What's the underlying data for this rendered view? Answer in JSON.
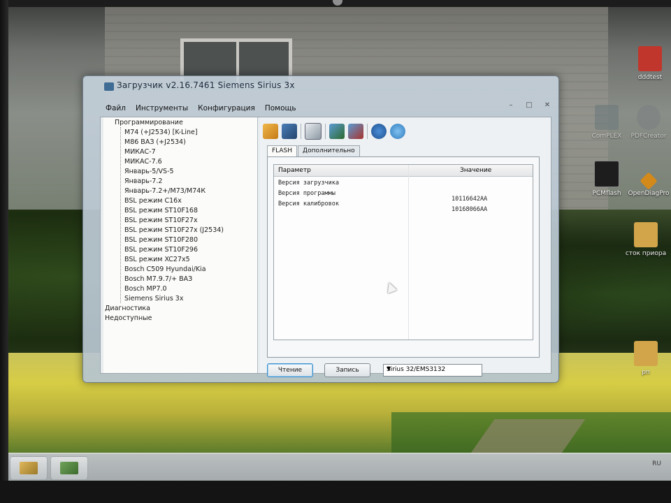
{
  "window": {
    "title": "Загрузчик v2.16.7461 Siemens Sirius 3x",
    "minimize_glyph": "–",
    "maximize_glyph": "□",
    "close_glyph": "✕"
  },
  "menu": [
    "Файл",
    "Инструменты",
    "Конфигурация",
    "Помощь"
  ],
  "tree": {
    "root": "Программирование",
    "items": [
      "M74 (+J2534) [K-Line]",
      "M86 ВАЗ (+J2534)",
      "МИКАС-7",
      "МИКАС-7.6",
      "Январь-5/VS-5",
      "Январь-7.2",
      "Январь-7.2+/M73/M74К",
      "BSL режим C16x",
      "BSL режим ST10F168",
      "BSL режим ST10F27x",
      "BSL режим ST10F27x (J2534)",
      "BSL режим ST10F280",
      "BSL режим ST10F296",
      "BSL режим XC27x5",
      "Bosch C509 Hyundai/Kia",
      "Bosch M7.9.7/+ ВАЗ",
      "Bosch MP7.0",
      "Siemens Sirius 3x"
    ],
    "other_roots": [
      "Диагностика",
      "Недоступные"
    ]
  },
  "toolbar": {
    "icons": [
      "open-folder-icon",
      "save-icon",
      "report-icon",
      "read-ecu-icon",
      "write-ecu-icon",
      "help-icon",
      "info-icon"
    ]
  },
  "tabs": [
    "FLASH",
    "Дополнительно"
  ],
  "table": {
    "headers": [
      "Параметр",
      "Значение"
    ],
    "rows": [
      {
        "param": "Версия загрузчика",
        "value": ""
      },
      {
        "param": "Версия программы",
        "value": "10116642AA"
      },
      {
        "param": "Версия калибровок",
        "value": "10168066AA"
      }
    ]
  },
  "buttons": {
    "read": "Чтение",
    "write": "Запись"
  },
  "ecu_select": {
    "value": "Sirius 32/EMS3132"
  },
  "desktop_icons": [
    {
      "label": "dddtest",
      "color": "#c0362c"
    },
    {
      "label": "ComPLEX",
      "color": "#6d7a7c"
    },
    {
      "label": "PDFCreator",
      "color": "#7c8082"
    },
    {
      "label": "PCMflash",
      "color": "#1d1d1d"
    },
    {
      "label": "OpenDiagPro",
      "color": "#d38a1a"
    },
    {
      "label": "сток приора",
      "color": "#d2a54a"
    },
    {
      "label": "рп",
      "color": "#d2a54a"
    }
  ],
  "tray": {
    "lang": "RU"
  }
}
